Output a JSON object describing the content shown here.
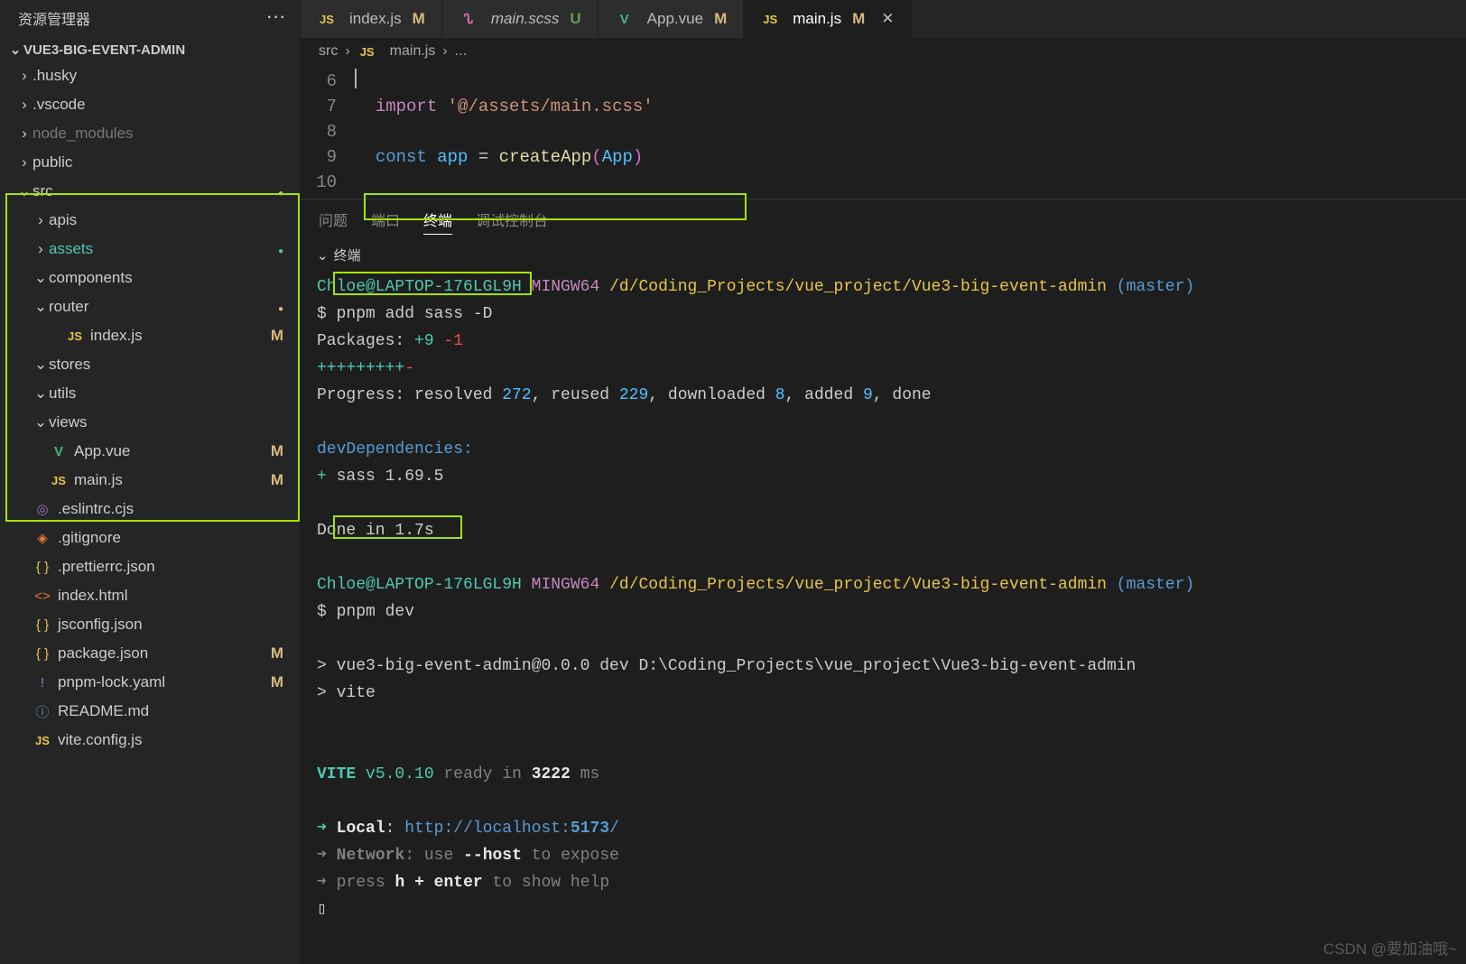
{
  "explorer": {
    "title": "资源管理器",
    "project": "VUE3-BIG-EVENT-ADMIN",
    "items": [
      {
        "indent": 1,
        "chev": "›",
        "label": ".husky"
      },
      {
        "indent": 1,
        "chev": "›",
        "label": ".vscode"
      },
      {
        "indent": 1,
        "chev": "›",
        "label": "node_modules",
        "dim": true
      },
      {
        "indent": 1,
        "chev": "›",
        "label": "public"
      },
      {
        "indent": 1,
        "chev": "⌄",
        "label": "src",
        "status": "dot"
      },
      {
        "indent": 2,
        "chev": "›",
        "label": "apis"
      },
      {
        "indent": 2,
        "chev": "›",
        "label": "assets",
        "active": true,
        "status": "dotgreen"
      },
      {
        "indent": 2,
        "chev": "⌄",
        "label": "components"
      },
      {
        "indent": 2,
        "chev": "⌄",
        "label": "router",
        "status": "dot"
      },
      {
        "indent": 3,
        "icon": "JS",
        "iconClass": "js-ic",
        "label": "index.js",
        "status": "M"
      },
      {
        "indent": 2,
        "chev": "⌄",
        "label": "stores"
      },
      {
        "indent": 2,
        "chev": "⌄",
        "label": "utils"
      },
      {
        "indent": 2,
        "chev": "⌄",
        "label": "views"
      },
      {
        "indent": 2,
        "icon": "V",
        "iconClass": "vue-ic",
        "label": "App.vue",
        "status": "M"
      },
      {
        "indent": 2,
        "icon": "JS",
        "iconClass": "js-ic",
        "label": "main.js",
        "status": "M"
      },
      {
        "indent": 1,
        "icon": "◎",
        "iconClass": "yaml-ic",
        "label": ".eslintrc.cjs"
      },
      {
        "indent": 1,
        "icon": "◈",
        "iconClass": "git-ic",
        "label": ".gitignore"
      },
      {
        "indent": 1,
        "icon": "{ }",
        "iconClass": "json-ic",
        "label": ".prettierrc.json"
      },
      {
        "indent": 1,
        "icon": "<>",
        "iconClass": "html-ic",
        "label": "index.html"
      },
      {
        "indent": 1,
        "icon": "{ }",
        "iconClass": "json-ic",
        "label": "jsconfig.json"
      },
      {
        "indent": 1,
        "icon": "{ }",
        "iconClass": "json-ic",
        "label": "package.json",
        "status": "M"
      },
      {
        "indent": 1,
        "icon": "!",
        "iconClass": "yaml-ic",
        "label": "pnpm-lock.yaml",
        "status": "M"
      },
      {
        "indent": 1,
        "icon": "ⓘ",
        "iconClass": "md-ic",
        "label": "README.md"
      },
      {
        "indent": 1,
        "icon": "JS",
        "iconClass": "js-ic",
        "label": "vite.config.js"
      }
    ]
  },
  "tabs": [
    {
      "icon": "JS",
      "iconClass": "js-ic",
      "label": "index.js",
      "status": "M"
    },
    {
      "icon": "ᔐ",
      "iconClass": "scss-ic",
      "label": "main.scss",
      "status": "U",
      "italic": true
    },
    {
      "icon": "V",
      "iconClass": "vue-ic",
      "label": "App.vue",
      "status": "M"
    },
    {
      "icon": "JS",
      "iconClass": "js-ic",
      "label": "main.js",
      "status": "M",
      "active": true,
      "close": true
    }
  ],
  "breadcrumb": {
    "src": "src",
    "file": "main.js",
    "rest": "..."
  },
  "code": {
    "line6": "6",
    "line7": "7",
    "line7_import": "import",
    "line7_str": "'@/assets/main.scss'",
    "line8": "8",
    "line9": "9",
    "line9_const": "const",
    "line9_app": "app",
    "line9_eq": " = ",
    "line9_fn": "createApp",
    "line9_arg": "App",
    "line10": "10"
  },
  "panel": {
    "tabs": {
      "problems": "问题",
      "ports": "端口",
      "terminal": "终端",
      "debug": "调试控制台"
    },
    "terminal_label": "终端"
  },
  "term": {
    "prompt_user": "Chloe@LAPTOP-176LGL9H",
    "prompt_sys": "MINGW64",
    "prompt_path": "/d/Coding_Projects/vue_project/Vue3-big-event-admin",
    "prompt_branch": "(master)",
    "dollar": "$",
    "cmd1": "pnpm add sass -D",
    "packages_lbl": "Packages:",
    "packages_plus": "+9",
    "packages_minus": "-1",
    "pluses": "+++++++++",
    "minus": "-",
    "progress_lbl": "Progress: resolved",
    "resolved": "272",
    "reused_lbl": ", reused",
    "reused": "229",
    "downloaded_lbl": ", downloaded",
    "downloaded": "8",
    "added_lbl": ", added",
    "added": "9",
    "done": ", done",
    "devdep": "devDependencies:",
    "sass_plus": "+",
    "sass": "sass 1.69.5",
    "done_in": "Done in 1.7s",
    "cmd2": "pnpm dev",
    "run1": "> vue3-big-event-admin@0.0.0 dev D:\\Coding_Projects\\vue_project\\Vue3-big-event-admin",
    "run2": "> vite",
    "vite_lbl": "VITE",
    "vite_ver": "v5.0.10",
    "ready_lbl": "ready in",
    "ready_ms": "3222",
    "ms": "ms",
    "arrow": "➜ ",
    "local_lbl": "Local",
    "local_url_a": "http://localhost:",
    "local_port": "5173",
    "local_slash": "/",
    "network_lbl": "Network",
    "network_txt1": ": use",
    "network_host": "--host",
    "network_txt2": "to expose",
    "press_lbl": "press",
    "press_key": "h + enter",
    "press_txt": "to show help"
  },
  "watermark": "CSDN @要加油哦~"
}
